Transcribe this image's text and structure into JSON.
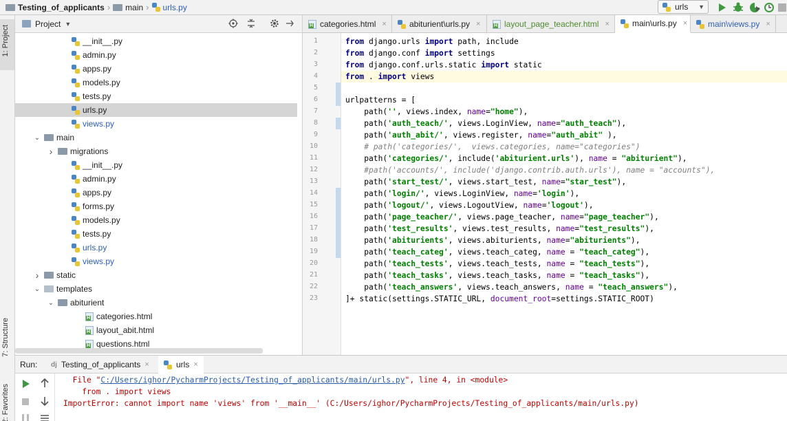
{
  "breadcrumb": {
    "project": "Testing_of_applicants",
    "folder": "main",
    "file": "urls.py"
  },
  "run_config": {
    "selected": "urls",
    "buttons": [
      "run-icon",
      "debug-icon",
      "coverage-icon",
      "profile-icon",
      "stop-icon"
    ]
  },
  "side_tabs": {
    "project": "1: Project",
    "structure": "7: Structure",
    "favorites": "2: Favorites"
  },
  "project_panel": {
    "title": "Project",
    "tree": [
      {
        "label": "__init__.py",
        "type": "py",
        "indent": 3,
        "color": "normal"
      },
      {
        "label": "admin.py",
        "type": "py",
        "indent": 3,
        "color": "normal"
      },
      {
        "label": "apps.py",
        "type": "py",
        "indent": 3,
        "color": "normal"
      },
      {
        "label": "models.py",
        "type": "py",
        "indent": 3,
        "color": "normal"
      },
      {
        "label": "tests.py",
        "type": "py",
        "indent": 3,
        "color": "normal"
      },
      {
        "label": "urls.py",
        "type": "py",
        "indent": 3,
        "color": "normal",
        "selected": true
      },
      {
        "label": "views.py",
        "type": "py",
        "indent": 3,
        "color": "blue"
      },
      {
        "label": "main",
        "type": "folder",
        "indent": 1,
        "arrow": "open"
      },
      {
        "label": "migrations",
        "type": "folder",
        "indent": 2,
        "arrow": "closed"
      },
      {
        "label": "__init__.py",
        "type": "py",
        "indent": 3,
        "color": "normal"
      },
      {
        "label": "admin.py",
        "type": "py",
        "indent": 3,
        "color": "normal"
      },
      {
        "label": "apps.py",
        "type": "py",
        "indent": 3,
        "color": "normal"
      },
      {
        "label": "forms.py",
        "type": "py",
        "indent": 3,
        "color": "normal"
      },
      {
        "label": "models.py",
        "type": "py",
        "indent": 3,
        "color": "normal"
      },
      {
        "label": "tests.py",
        "type": "py",
        "indent": 3,
        "color": "normal"
      },
      {
        "label": "urls.py",
        "type": "py",
        "indent": 3,
        "color": "blue"
      },
      {
        "label": "views.py",
        "type": "py",
        "indent": 3,
        "color": "blue"
      },
      {
        "label": "static",
        "type": "folder",
        "indent": 1,
        "arrow": "closed"
      },
      {
        "label": "templates",
        "type": "folder-light",
        "indent": 1,
        "arrow": "open"
      },
      {
        "label": "abiturient",
        "type": "folder",
        "indent": 2,
        "arrow": "open"
      },
      {
        "label": "categories.html",
        "type": "html",
        "indent": 4,
        "color": "normal"
      },
      {
        "label": "layout_abit.html",
        "type": "html",
        "indent": 4,
        "color": "normal"
      },
      {
        "label": "questions.html",
        "type": "html",
        "indent": 4,
        "color": "normal"
      }
    ]
  },
  "editor_tabs": [
    {
      "label": "categories.html",
      "type": "html",
      "active": false,
      "color": "#222222"
    },
    {
      "label": "abiturient\\urls.py",
      "type": "py",
      "active": false,
      "color": "#222222"
    },
    {
      "label": "layout_page_teacher.html",
      "type": "html",
      "active": false,
      "color": "#4e8a2f"
    },
    {
      "label": "main\\urls.py",
      "type": "py",
      "active": true,
      "color": "#222222"
    },
    {
      "label": "main\\views.py",
      "type": "py",
      "active": false,
      "color": "#2f5fb5"
    }
  ],
  "code_lines": [
    "<span class=\"kw\">from</span> django.urls <span class=\"kw\">import</span> path, include",
    "<span class=\"kw\">from</span> django.conf <span class=\"kw\">import</span> settings",
    "<span class=\"kw\">from</span> django.conf.urls.static <span class=\"kw\">import</span> static",
    "<span class=\"kw\">from</span> . <span class=\"kw\">import</span> views",
    "",
    "urlpatterns = [",
    "    path(<span class=\"str\">''</span>, views.index, <span class=\"kwarg\">name</span>=<span class=\"str\">\"home\"</span>),",
    "    path(<span class=\"str\">'auth_teach/'</span>, views.LoginView, <span class=\"kwarg\">name</span>=<span class=\"str\">\"auth_teach\"</span>),",
    "    path(<span class=\"str\">'auth_abit/'</span>, views.register, <span class=\"kwarg\">name</span>=<span class=\"str\">\"auth_abit\"</span> ),",
    "    <span class=\"cmt\"># path('categories/',  views.categories, name=\"categories\")</span>",
    "    path(<span class=\"str\">'categories/'</span>, include(<span class=\"str\">'abiturient.urls'</span>), <span class=\"kwarg\">name</span> = <span class=\"str\">\"abiturient\"</span>),",
    "    <span class=\"cmt\">#path('accounts/', include('django.contrib.auth.urls'), name = \"accounts\"),</span>",
    "    path(<span class=\"str\">'start_test/'</span>, views.start_test, <span class=\"kwarg\">name</span>=<span class=\"str\">\"star_test\"</span>),",
    "    path(<span class=\"str\">'login/'</span>, views.LoginView, <span class=\"kwarg\">name</span>=<span class=\"str\">'login'</span>),",
    "    path(<span class=\"str\">'logout/'</span>, views.LogoutView, <span class=\"kwarg\">name</span>=<span class=\"str\">'logout'</span>),",
    "    path(<span class=\"str\">'page_teacher/'</span>, views.page_teacher, <span class=\"kwarg\">name</span>=<span class=\"str\">\"page_teacher\"</span>),",
    "    path(<span class=\"str\">'test_results'</span>, views.test_results, <span class=\"kwarg\">name</span>=<span class=\"str\">\"test_results\"</span>),",
    "    path(<span class=\"str\">'abiturients'</span>, views.abiturients, <span class=\"kwarg\">name</span>=<span class=\"str\">\"abiturients\"</span>),",
    "    path(<span class=\"str\">'teach_categ'</span>, views.teach_categ, <span class=\"kwarg\">name</span> = <span class=\"str\">\"teach_categ\"</span>),",
    "    path(<span class=\"str\">'teach_tests'</span>, views.teach_tests, <span class=\"kwarg\">name</span> = <span class=\"str\">\"teach_tests\"</span>),",
    "    path(<span class=\"str\">'teach_tasks'</span>, views.teach_tasks, <span class=\"kwarg\">name</span> = <span class=\"str\">\"teach_tasks\"</span>),",
    "    path(<span class=\"str\">'teach_answers'</span>, views.teach_answers, <span class=\"kwarg\">name</span> = <span class=\"str\">\"teach_answers\"</span>),",
    "]+ static(settings.STATIC_URL, <span class=\"kwarg\">document_root</span>=settings.STATIC_ROOT)"
  ],
  "current_line": 4,
  "run_panel": {
    "label": "Run:",
    "tabs": [
      {
        "label": "Testing_of_applicants",
        "active": false
      },
      {
        "label": "urls",
        "active": true
      }
    ],
    "output": {
      "line1_prefix": "  File \"",
      "line1_path": "C:/Users/ighor/PycharmProjects/Testing_of_applicants/main/urls.py",
      "line1_suffix": "\", line 4, in <module>",
      "line2": "    from . import views",
      "line3": "ImportError: cannot import name 'views' from '__main__' (C:/Users/ighor/PycharmProjects/Testing_of_applicants/main/urls.py)"
    }
  }
}
